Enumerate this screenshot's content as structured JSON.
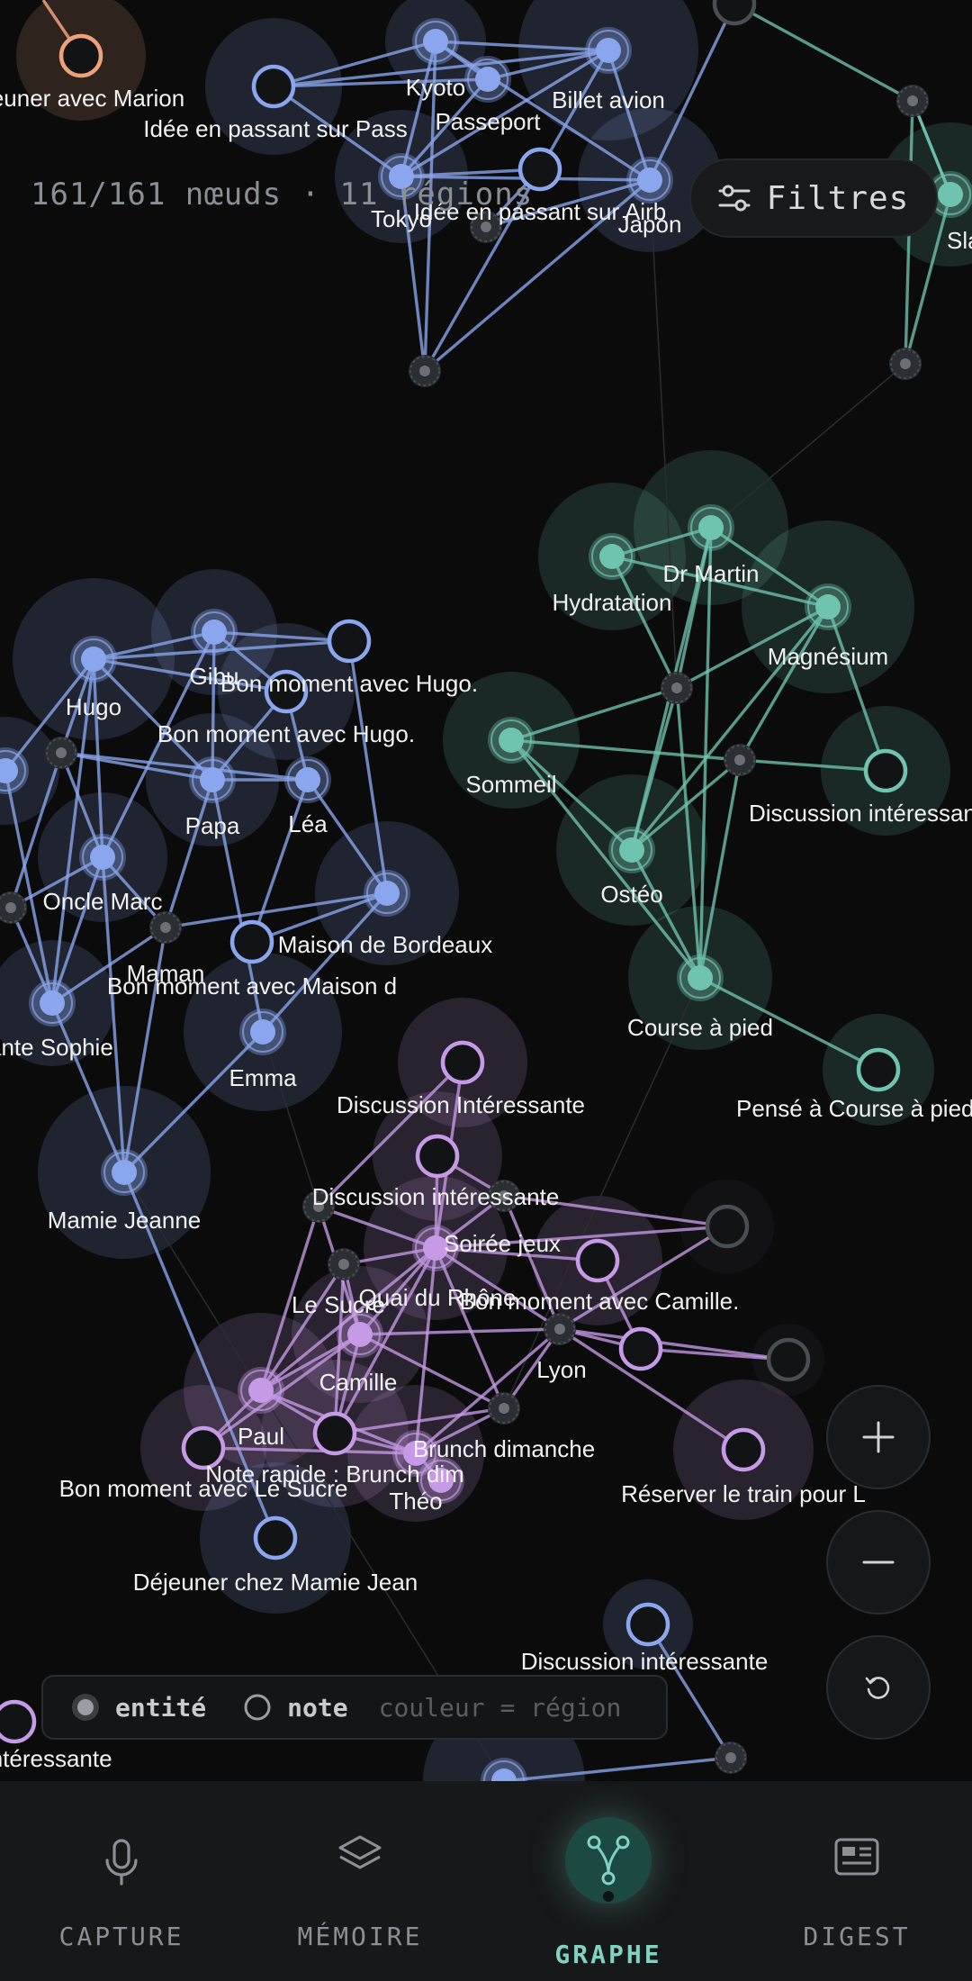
{
  "colors": {
    "background": "#0b0b0c",
    "blue": "#8aa6ee",
    "teal": "#6fc4b0",
    "purple": "#c69ae6",
    "orange": "#eea27a",
    "grey": "#4a4d52",
    "accent": "#7fd3c0"
  },
  "counter": {
    "text": "161/161 nœuds · 11 régions"
  },
  "filters": {
    "label": "Filtres",
    "icon": "sliders-icon"
  },
  "legend": {
    "entity_label": "entité",
    "note_label": "note",
    "color_hint": "couleur = région"
  },
  "zoom": {
    "in_icon": "plus-icon",
    "out_icon": "minus-icon",
    "reset_icon": "reset-icon"
  },
  "nav": {
    "items": [
      {
        "label": "CAPTURE",
        "icon": "microphone-icon",
        "active": false
      },
      {
        "label": "MÉMOIRE",
        "icon": "layers-icon",
        "active": false
      },
      {
        "label": "GRAPHE",
        "icon": "graph-icon",
        "active": true
      },
      {
        "label": "DIGEST",
        "icon": "newspaper-icon",
        "active": false
      }
    ]
  },
  "graph": {
    "labels": {
      "dejeuner_marion": "Déjeuner avec Marion",
      "idee_pass": "Idée en passant sur Pass",
      "kyoto": "Kyoto",
      "passeport": "Passeport",
      "billet_avion": "Billet avion",
      "tokyo": "Tokyo",
      "idee_airb": "Idée en passant sur Airb",
      "japon": "Japon",
      "slack": "Slack",
      "hydratation": "Hydratation",
      "dr_martin": "Dr Martin",
      "magnesium": "Magnésium",
      "sommeil": "Sommeil",
      "discussion_teal": "Discussion intéressante",
      "osteo": "Ostéo",
      "course": "Course à pied",
      "pense_course": "Pensé à Course à pied",
      "hugo": "Hugo",
      "gibu": "Gibu",
      "bon_moment_hugo_1": "Bon moment avec Hugo.",
      "bon_moment_hugo_2": "Bon moment avec Hugo.",
      "papa": "Papa",
      "lea": "Léa",
      "oncle_marc": "Oncle Marc",
      "maman": "Maman",
      "maison_bordeaux": "Maison de Bordeaux",
      "bon_moment_maison": "Bon moment avec Maison d",
      "tante_sophie": "Tante Sophie",
      "emma": "Emma",
      "mamie_jeanne": "Mamie Jeanne",
      "discussion_p1": "Discussion Intéressante",
      "discussion_p2": "Discussion intéressante",
      "soiree_jeux": "Soirée jeux",
      "le_sucre": "Le Sucre",
      "quai_rhone": "Quai du Rhône",
      "bon_moment_camille": "Bon moment avec Camille.",
      "lyon": "Lyon",
      "camille": "Camille",
      "paul": "Paul",
      "brunch": "Brunch dimanche",
      "note_brunch": "Note rapide : Brunch dim",
      "bon_moment_sucre": "Bon moment avec Le Sucre",
      "theo": "Théo",
      "reserver_train": "Réserver le train pour L",
      "dejeuner_mamie": "Déjeuner chez Mamie Jean",
      "discussion_bottom": "Discussion intéressante",
      "interessante_left": "Discussion intéressante"
    }
  }
}
